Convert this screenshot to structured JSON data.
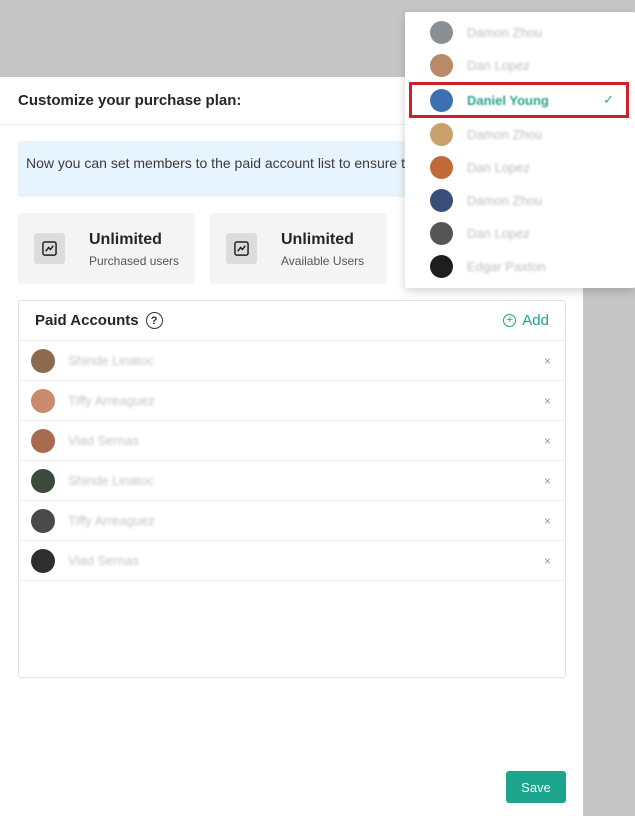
{
  "panel": {
    "title": "Customize your purchase plan:",
    "info_text": "Now you can set members to the paid account list to ensure they can use properly."
  },
  "stats": [
    {
      "value": "Unlimited",
      "label": "Purchased users",
      "icon": "chart-icon"
    },
    {
      "value": "Unlimited",
      "label": "Available Users",
      "icon": "chart-icon"
    }
  ],
  "accounts": {
    "title": "Paid Accounts",
    "help_glyph": "?",
    "add_label": "Add",
    "add_glyph": "+",
    "close_glyph": "×",
    "rows": [
      {
        "name": "Shinde Linatoc",
        "avatar_color": "#8b6a4e"
      },
      {
        "name": "Tiffy Arreaguez",
        "avatar_color": "#c98a6e"
      },
      {
        "name": "Vlad Sernas",
        "avatar_color": "#a96b4f"
      },
      {
        "name": "Shinde Linatoc",
        "avatar_color": "#3b4a3a"
      },
      {
        "name": "Tiffy Arreaguez",
        "avatar_color": "#4a4a4a"
      },
      {
        "name": "Vlad Sernas",
        "avatar_color": "#2f2f2f"
      }
    ]
  },
  "dropdown": {
    "check_glyph": "✓",
    "items": [
      {
        "name": "Damon Zhou",
        "avatar_color": "#8a8f94",
        "selected": false
      },
      {
        "name": "Dan Lopez",
        "avatar_color": "#b88a6a",
        "selected": false
      },
      {
        "name": "Daniel Young",
        "avatar_color": "#3d6fb3",
        "selected": true
      },
      {
        "name": "Damon Zhou",
        "avatar_color": "#c9a16a",
        "selected": false
      },
      {
        "name": "Dan Lopez",
        "avatar_color": "#c06a3a",
        "selected": false
      },
      {
        "name": "Damon Zhou",
        "avatar_color": "#3a4e7a",
        "selected": false
      },
      {
        "name": "Dan Lopez",
        "avatar_color": "#555555",
        "selected": false
      },
      {
        "name": "Edgar Paxton",
        "avatar_color": "#1e1e1e",
        "selected": false
      }
    ]
  },
  "footer": {
    "save_label": "Save"
  },
  "colors": {
    "accent": "#1aa58c",
    "highlight": "#d0202a",
    "banner": "#e8f4fd"
  }
}
